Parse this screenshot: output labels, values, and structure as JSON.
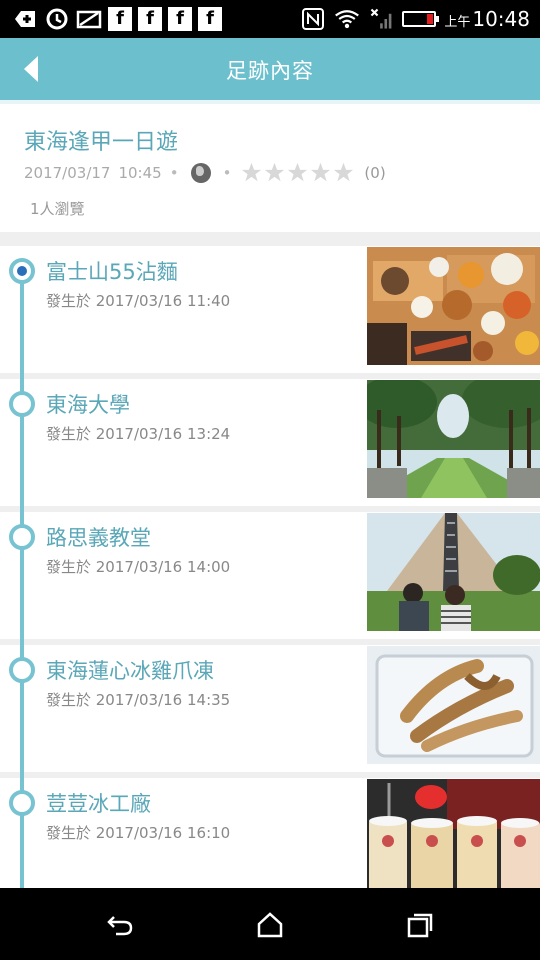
{
  "status_bar": {
    "ampm": "上午",
    "time": "10:48",
    "colors": {
      "battery_low": "#e02020"
    }
  },
  "header": {
    "title": "足跡內容",
    "back_icon": "chevron-left-icon",
    "background": "#6cc0cd"
  },
  "trip": {
    "title": "東海逢甲一日遊",
    "date": "2017/03/17",
    "time": "10:45",
    "privacy_icon": "globe-icon",
    "rating_stars": 0,
    "rating_count": "(0)",
    "views": "1人瀏覽"
  },
  "entries": [
    {
      "title": "富士山55沾麵",
      "time": "發生於 2017/03/16  11:40",
      "active": true
    },
    {
      "title": "東海大學",
      "time": "發生於 2017/03/16  13:24",
      "active": false
    },
    {
      "title": "路思義教堂",
      "time": "發生於 2017/03/16  14:00",
      "active": false
    },
    {
      "title": "東海蓮心冰雞爪凍",
      "time": "發生於 2017/03/16  14:35",
      "active": false
    },
    {
      "title": "荳荳冰工廠",
      "time": "發生於 2017/03/16  16:10",
      "active": false
    }
  ],
  "nav_bar": {
    "back_icon": "back-arrow-icon",
    "home_icon": "home-icon",
    "recents_icon": "recents-icon"
  }
}
